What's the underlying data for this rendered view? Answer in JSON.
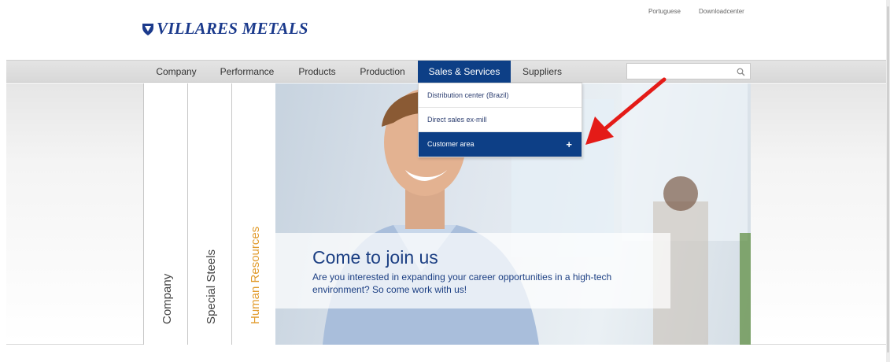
{
  "top_links": {
    "portuguese": "Portuguese",
    "downloadcenter": "Downloadcenter"
  },
  "logo": {
    "text": "VILLARES METALS",
    "icon": "shield-logo-icon"
  },
  "nav": {
    "items": [
      {
        "label": "Company"
      },
      {
        "label": "Performance"
      },
      {
        "label": "Products"
      },
      {
        "label": "Production"
      },
      {
        "label": "Sales & Services",
        "active": true
      },
      {
        "label": "Suppliers"
      }
    ]
  },
  "search": {
    "placeholder": "",
    "value": "",
    "icon": "search-icon"
  },
  "dropdown": {
    "items": [
      {
        "label": "Distribution center (Brazil)"
      },
      {
        "label": "Direct sales ex-mill"
      },
      {
        "label": "Customer area",
        "highlight": true,
        "expand_symbol": "+"
      }
    ]
  },
  "side_tabs": [
    {
      "label": "Company"
    },
    {
      "label": "Special Steels"
    },
    {
      "label": "Human Resources",
      "accent": true
    }
  ],
  "hero": {
    "title": "Come to join us",
    "text": "Are you interested in expanding your career opportunities in a high-tech environment? So come work with us!"
  },
  "annotation": {
    "icon": "red-arrow-icon",
    "color": "#e41b17"
  },
  "colors": {
    "brand_blue": "#0d3f86",
    "logo_blue": "#1b3a8c",
    "hr_orange": "#e19b2c"
  }
}
